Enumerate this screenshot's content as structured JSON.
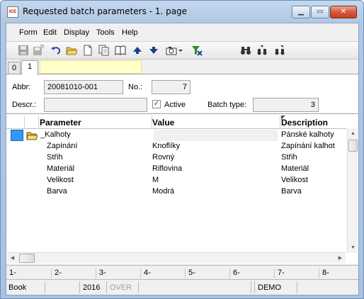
{
  "window": {
    "title": "Requested batch parameters - 1. page",
    "app_icon_text": "ICE"
  },
  "menu": [
    "Form",
    "Edit",
    "Display",
    "Tools",
    "Help"
  ],
  "toolbar_icons": [
    "save-icon",
    "save-as-icon",
    "undo-icon",
    "open-folder-icon",
    "new-document-icon",
    "copy-icon",
    "book-icon",
    "arrow-up-icon",
    "arrow-down-icon",
    "camera-icon",
    "dropdown-arrow-icon",
    "filter-icon",
    "binoculars-icon",
    "binoculars-next-icon",
    "binoculars-prev-icon"
  ],
  "tabs": [
    {
      "label": "0"
    },
    {
      "label": "1"
    }
  ],
  "form": {
    "abbr_label": "Abbr:",
    "abbr_value": "20081010-001",
    "no_label": "No.:",
    "no_value": "7",
    "descr_label": "Descr.:",
    "descr_value": "",
    "active_label": "Active",
    "active_checked": true,
    "batch_type_label": "Batch type:",
    "batch_type_value": "3"
  },
  "grid": {
    "columns": [
      "Parameter",
      "Value",
      "Description"
    ],
    "rows": [
      {
        "parameter": "_Kalhoty",
        "value": "",
        "description": "Pánské kalhoty",
        "is_folder": true
      },
      {
        "parameter": "Zapínání",
        "value": "Knoflíky",
        "description": "Zapínání kalhot"
      },
      {
        "parameter": "Střih",
        "value": "Rovný",
        "description": "Střih"
      },
      {
        "parameter": "Materiál",
        "value": "Riflovina",
        "description": "Materiál"
      },
      {
        "parameter": "Velikost",
        "value": "M",
        "description": "Velikost"
      },
      {
        "parameter": "Barva",
        "value": "Modrá",
        "description": "Barva"
      }
    ]
  },
  "fkeys": [
    "1-",
    "2-",
    "3-",
    "4-",
    "5-",
    "6-",
    "7-",
    "8-"
  ],
  "status": {
    "module": "Book",
    "year": "2016",
    "mode": "OVER",
    "database": "DEMO"
  },
  "colors": {
    "title_bar": "#b1c8e4",
    "selection": "#3399ff",
    "close_button": "#c8401f"
  }
}
